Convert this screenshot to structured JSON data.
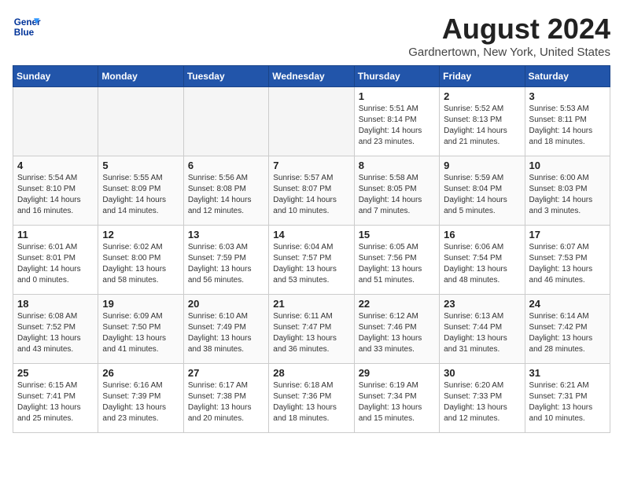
{
  "header": {
    "logo_line1": "General",
    "logo_line2": "Blue",
    "title": "August 2024",
    "subtitle": "Gardnertown, New York, United States"
  },
  "days_of_week": [
    "Sunday",
    "Monday",
    "Tuesday",
    "Wednesday",
    "Thursday",
    "Friday",
    "Saturday"
  ],
  "weeks": [
    [
      {
        "day": "",
        "info": ""
      },
      {
        "day": "",
        "info": ""
      },
      {
        "day": "",
        "info": ""
      },
      {
        "day": "",
        "info": ""
      },
      {
        "day": "1",
        "info": "Sunrise: 5:51 AM\nSunset: 8:14 PM\nDaylight: 14 hours\nand 23 minutes."
      },
      {
        "day": "2",
        "info": "Sunrise: 5:52 AM\nSunset: 8:13 PM\nDaylight: 14 hours\nand 21 minutes."
      },
      {
        "day": "3",
        "info": "Sunrise: 5:53 AM\nSunset: 8:11 PM\nDaylight: 14 hours\nand 18 minutes."
      }
    ],
    [
      {
        "day": "4",
        "info": "Sunrise: 5:54 AM\nSunset: 8:10 PM\nDaylight: 14 hours\nand 16 minutes."
      },
      {
        "day": "5",
        "info": "Sunrise: 5:55 AM\nSunset: 8:09 PM\nDaylight: 14 hours\nand 14 minutes."
      },
      {
        "day": "6",
        "info": "Sunrise: 5:56 AM\nSunset: 8:08 PM\nDaylight: 14 hours\nand 12 minutes."
      },
      {
        "day": "7",
        "info": "Sunrise: 5:57 AM\nSunset: 8:07 PM\nDaylight: 14 hours\nand 10 minutes."
      },
      {
        "day": "8",
        "info": "Sunrise: 5:58 AM\nSunset: 8:05 PM\nDaylight: 14 hours\nand 7 minutes."
      },
      {
        "day": "9",
        "info": "Sunrise: 5:59 AM\nSunset: 8:04 PM\nDaylight: 14 hours\nand 5 minutes."
      },
      {
        "day": "10",
        "info": "Sunrise: 6:00 AM\nSunset: 8:03 PM\nDaylight: 14 hours\nand 3 minutes."
      }
    ],
    [
      {
        "day": "11",
        "info": "Sunrise: 6:01 AM\nSunset: 8:01 PM\nDaylight: 14 hours\nand 0 minutes."
      },
      {
        "day": "12",
        "info": "Sunrise: 6:02 AM\nSunset: 8:00 PM\nDaylight: 13 hours\nand 58 minutes."
      },
      {
        "day": "13",
        "info": "Sunrise: 6:03 AM\nSunset: 7:59 PM\nDaylight: 13 hours\nand 56 minutes."
      },
      {
        "day": "14",
        "info": "Sunrise: 6:04 AM\nSunset: 7:57 PM\nDaylight: 13 hours\nand 53 minutes."
      },
      {
        "day": "15",
        "info": "Sunrise: 6:05 AM\nSunset: 7:56 PM\nDaylight: 13 hours\nand 51 minutes."
      },
      {
        "day": "16",
        "info": "Sunrise: 6:06 AM\nSunset: 7:54 PM\nDaylight: 13 hours\nand 48 minutes."
      },
      {
        "day": "17",
        "info": "Sunrise: 6:07 AM\nSunset: 7:53 PM\nDaylight: 13 hours\nand 46 minutes."
      }
    ],
    [
      {
        "day": "18",
        "info": "Sunrise: 6:08 AM\nSunset: 7:52 PM\nDaylight: 13 hours\nand 43 minutes."
      },
      {
        "day": "19",
        "info": "Sunrise: 6:09 AM\nSunset: 7:50 PM\nDaylight: 13 hours\nand 41 minutes."
      },
      {
        "day": "20",
        "info": "Sunrise: 6:10 AM\nSunset: 7:49 PM\nDaylight: 13 hours\nand 38 minutes."
      },
      {
        "day": "21",
        "info": "Sunrise: 6:11 AM\nSunset: 7:47 PM\nDaylight: 13 hours\nand 36 minutes."
      },
      {
        "day": "22",
        "info": "Sunrise: 6:12 AM\nSunset: 7:46 PM\nDaylight: 13 hours\nand 33 minutes."
      },
      {
        "day": "23",
        "info": "Sunrise: 6:13 AM\nSunset: 7:44 PM\nDaylight: 13 hours\nand 31 minutes."
      },
      {
        "day": "24",
        "info": "Sunrise: 6:14 AM\nSunset: 7:42 PM\nDaylight: 13 hours\nand 28 minutes."
      }
    ],
    [
      {
        "day": "25",
        "info": "Sunrise: 6:15 AM\nSunset: 7:41 PM\nDaylight: 13 hours\nand 25 minutes."
      },
      {
        "day": "26",
        "info": "Sunrise: 6:16 AM\nSunset: 7:39 PM\nDaylight: 13 hours\nand 23 minutes."
      },
      {
        "day": "27",
        "info": "Sunrise: 6:17 AM\nSunset: 7:38 PM\nDaylight: 13 hours\nand 20 minutes."
      },
      {
        "day": "28",
        "info": "Sunrise: 6:18 AM\nSunset: 7:36 PM\nDaylight: 13 hours\nand 18 minutes."
      },
      {
        "day": "29",
        "info": "Sunrise: 6:19 AM\nSunset: 7:34 PM\nDaylight: 13 hours\nand 15 minutes."
      },
      {
        "day": "30",
        "info": "Sunrise: 6:20 AM\nSunset: 7:33 PM\nDaylight: 13 hours\nand 12 minutes."
      },
      {
        "day": "31",
        "info": "Sunrise: 6:21 AM\nSunset: 7:31 PM\nDaylight: 13 hours\nand 10 minutes."
      }
    ]
  ]
}
